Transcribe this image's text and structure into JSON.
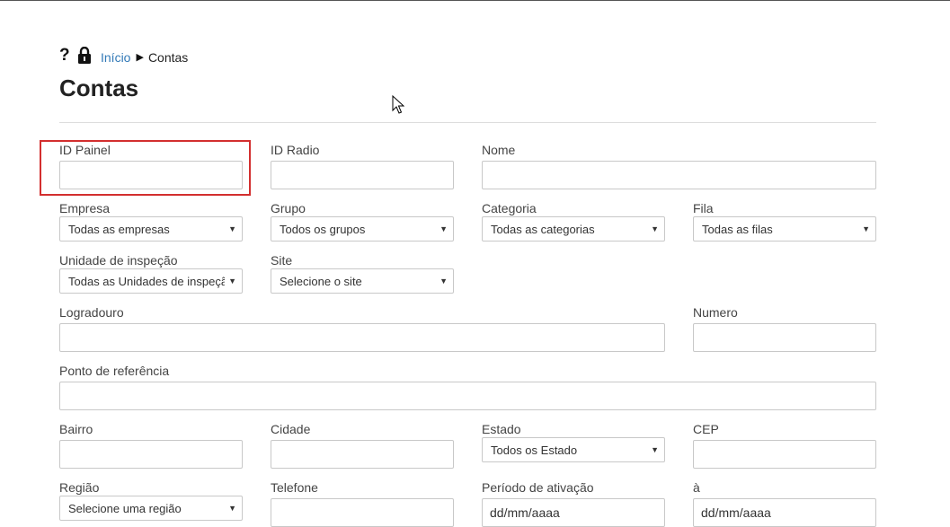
{
  "breadcrumb": {
    "help_icon": "question-mark-icon",
    "lock_icon": "padlock-icon",
    "home_label": "Início",
    "separator": "▶",
    "current_label": "Contas"
  },
  "page": {
    "title": "Contas"
  },
  "form": {
    "id_painel": {
      "label": "ID Painel",
      "value": ""
    },
    "id_radio": {
      "label": "ID Radio",
      "value": ""
    },
    "nome": {
      "label": "Nome",
      "value": ""
    },
    "empresa": {
      "label": "Empresa",
      "selected": "Todas as empresas"
    },
    "grupo": {
      "label": "Grupo",
      "selected": "Todos os grupos"
    },
    "categoria": {
      "label": "Categoria",
      "selected": "Todas as categorias"
    },
    "fila": {
      "label": "Fila",
      "selected": "Todas as filas"
    },
    "unidade": {
      "label": "Unidade de inspeção",
      "selected": "Todas as Unidades de inspeção"
    },
    "site": {
      "label": "Site",
      "selected": "Selecione o site"
    },
    "logradouro": {
      "label": "Logradouro",
      "value": ""
    },
    "numero": {
      "label": "Numero",
      "value": ""
    },
    "ponto_referencia": {
      "label": "Ponto de referência",
      "value": ""
    },
    "bairro": {
      "label": "Bairro",
      "value": ""
    },
    "cidade": {
      "label": "Cidade",
      "value": ""
    },
    "estado": {
      "label": "Estado",
      "selected": "Todos os Estado"
    },
    "cep": {
      "label": "CEP",
      "value": ""
    },
    "regiao": {
      "label": "Região",
      "selected": "Selecione uma região"
    },
    "telefone": {
      "label": "Telefone",
      "value": ""
    },
    "periodo_inicio": {
      "label": "Período de ativação",
      "value": "dd/mm/aaaa"
    },
    "periodo_fim": {
      "label": "à",
      "value": "dd/mm/aaaa"
    }
  },
  "colors": {
    "link": "#337ab7",
    "highlight": "#d32f2f",
    "border": "#c8c8c8"
  }
}
